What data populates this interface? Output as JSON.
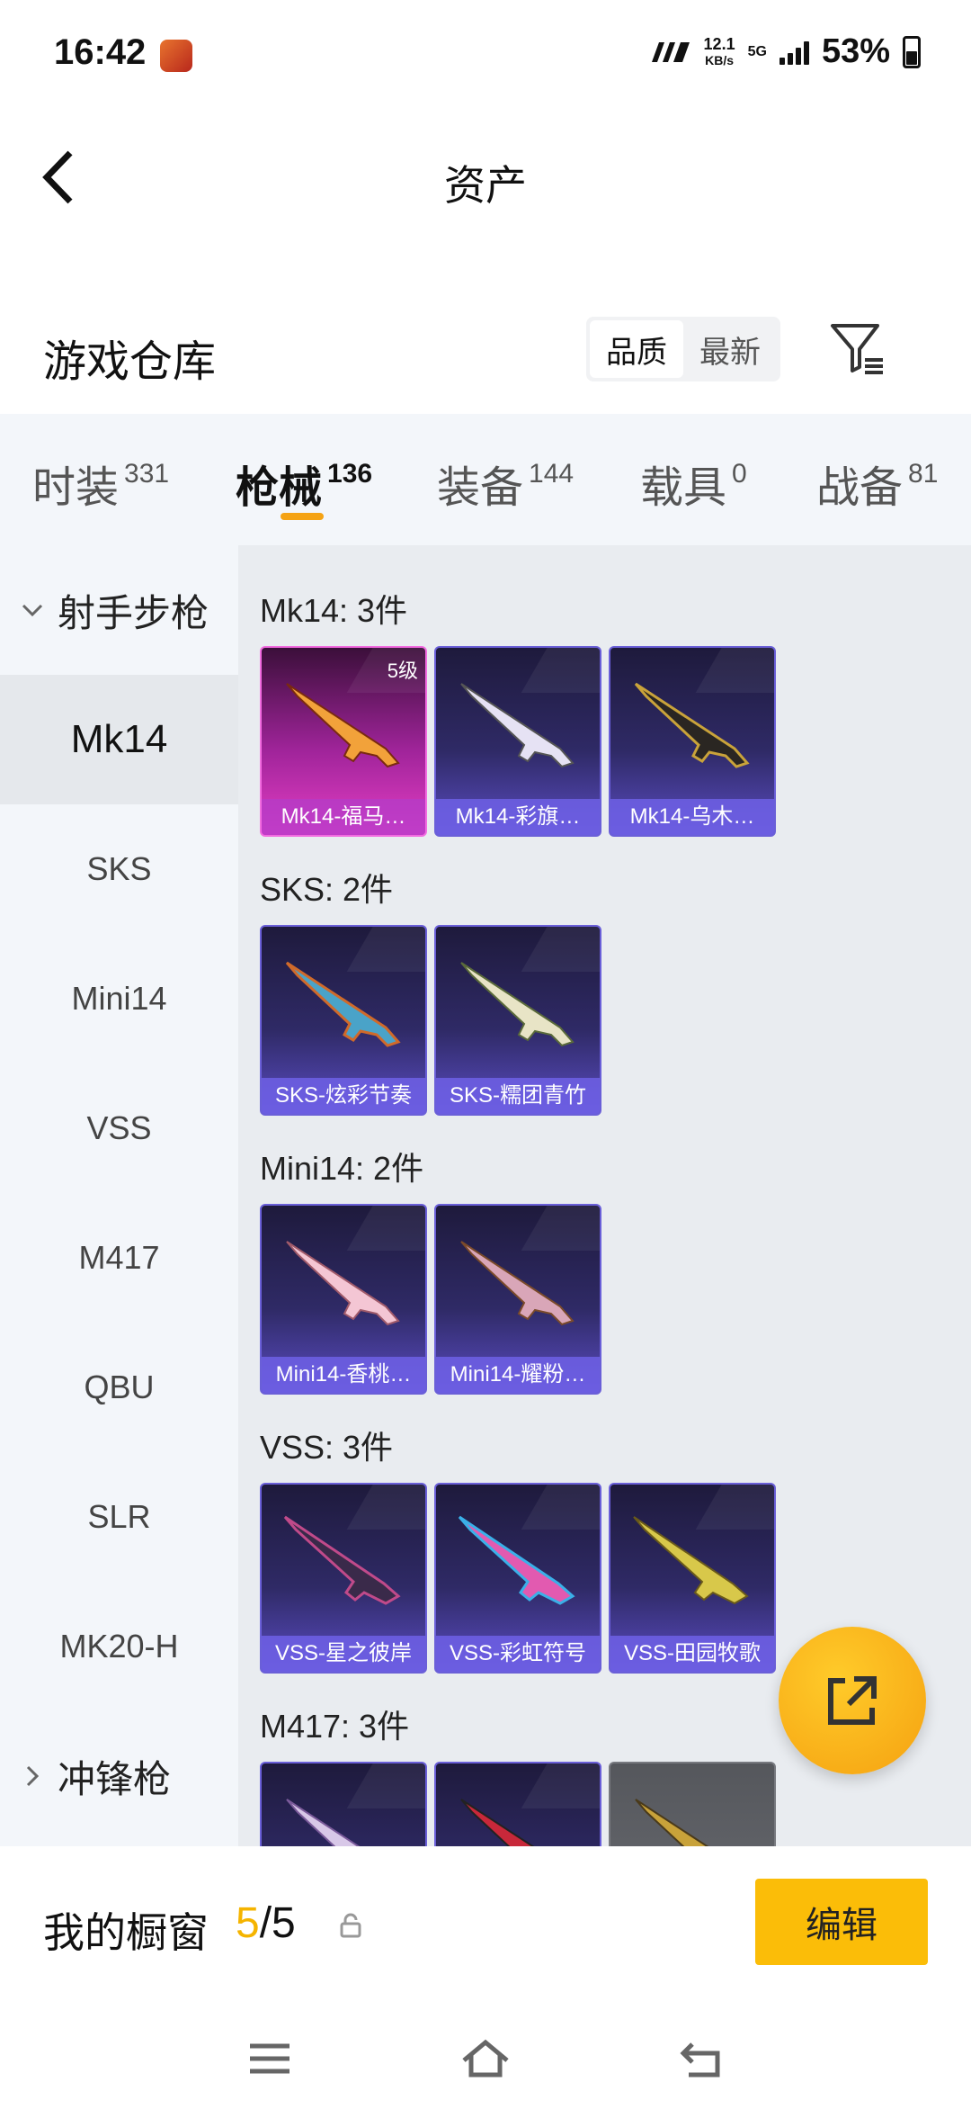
{
  "status_bar": {
    "time": "16:42",
    "net_speed": "12.1",
    "net_speed_unit": "KB/s",
    "network_type": "5G",
    "battery": "53%"
  },
  "header": {
    "title": "资产"
  },
  "warehouse": {
    "title": "游戏仓库",
    "sort_options": [
      "品质",
      "最新"
    ],
    "active_sort": "品质"
  },
  "tabs": [
    {
      "label": "时装",
      "count": "331"
    },
    {
      "label": "枪械",
      "count": "136"
    },
    {
      "label": "装备",
      "count": "144"
    },
    {
      "label": "载具",
      "count": "0"
    },
    {
      "label": "战备",
      "count": "81"
    }
  ],
  "active_tab": "枪械",
  "accent_color": "#f5a314",
  "sidenav": {
    "group1": "射手步枪",
    "items": [
      "Mk14",
      "SKS",
      "Mini14",
      "VSS",
      "M417",
      "QBU",
      "SLR",
      "MK20-H"
    ],
    "active_item": "Mk14",
    "group2": "冲锋枪"
  },
  "sections": [
    {
      "title": "Mk14: 3件",
      "items": [
        {
          "name": "Mk14-福马…",
          "level": "5级",
          "style": "pink"
        },
        {
          "name": "Mk14-彩旗…"
        },
        {
          "name": "Mk14-乌木…"
        }
      ]
    },
    {
      "title": "SKS: 2件",
      "items": [
        {
          "name": "SKS-炫彩节奏"
        },
        {
          "name": "SKS-糯团青竹"
        }
      ]
    },
    {
      "title": "Mini14: 2件",
      "items": [
        {
          "name": "Mini14-香桃…"
        },
        {
          "name": "Mini14-耀粉…"
        }
      ]
    },
    {
      "title": "VSS: 3件",
      "items": [
        {
          "name": "VSS-星之彼岸"
        },
        {
          "name": "VSS-彩虹符号"
        },
        {
          "name": "VSS-田园牧歌"
        }
      ]
    },
    {
      "title": "M417: 3件"
    }
  ],
  "bottom": {
    "showcase_label": "我的橱窗",
    "showcase_current": "5",
    "showcase_total": "/5",
    "edit_label": "编辑"
  }
}
